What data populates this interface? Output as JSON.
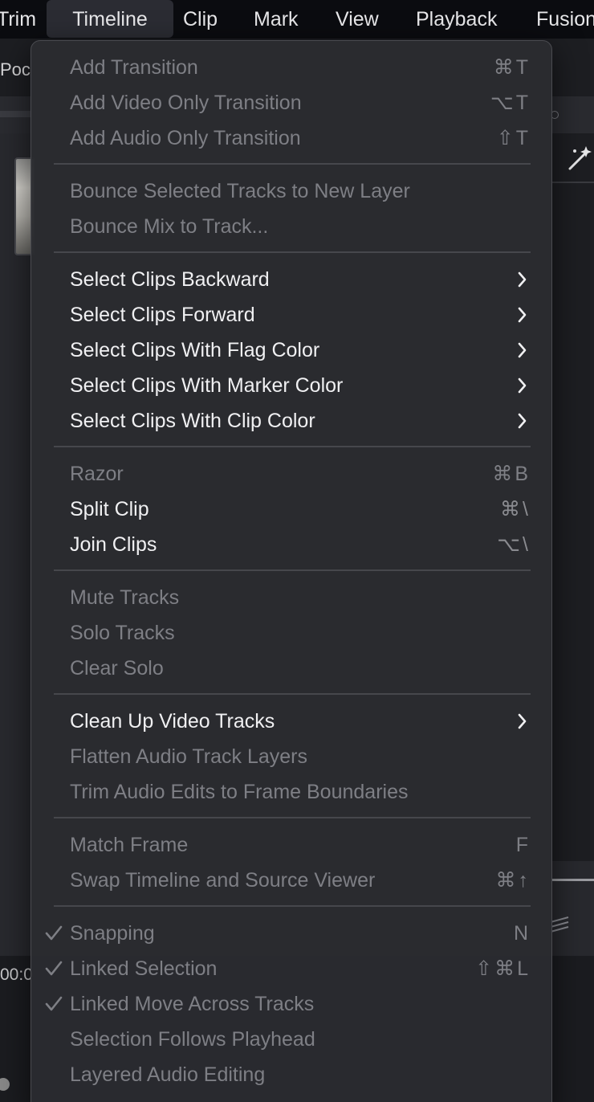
{
  "menubar": {
    "items": [
      "Trim",
      "Timeline",
      "Clip",
      "Mark",
      "View",
      "Playback",
      "Fusion"
    ],
    "active": "Timeline"
  },
  "background": {
    "toolbar_label": "Poc",
    "timecode": "00:0"
  },
  "menu": {
    "groups": [
      [
        {
          "label": "Add Transition",
          "shortcut": "⌘T",
          "enabled": false
        },
        {
          "label": "Add Video Only Transition",
          "shortcut": "⌥T",
          "enabled": false
        },
        {
          "label": "Add Audio Only Transition",
          "shortcut": "⇧T",
          "enabled": false
        }
      ],
      [
        {
          "label": "Bounce Selected Tracks to New Layer",
          "shortcut": "",
          "enabled": false
        },
        {
          "label": "Bounce Mix to Track...",
          "shortcut": "",
          "enabled": false
        }
      ],
      [
        {
          "label": "Select Clips Backward",
          "submenu": true,
          "enabled": true
        },
        {
          "label": "Select Clips Forward",
          "submenu": true,
          "enabled": true
        },
        {
          "label": "Select Clips With Flag Color",
          "submenu": true,
          "enabled": true
        },
        {
          "label": "Select Clips With Marker Color",
          "submenu": true,
          "enabled": true
        },
        {
          "label": "Select Clips With Clip Color",
          "submenu": true,
          "enabled": true
        }
      ],
      [
        {
          "label": "Razor",
          "shortcut": "⌘B",
          "enabled": false
        },
        {
          "label": "Split Clip",
          "shortcut": "⌘\\",
          "enabled": true
        },
        {
          "label": "Join Clips",
          "shortcut": "⌥\\",
          "enabled": true
        }
      ],
      [
        {
          "label": "Mute Tracks",
          "shortcut": "",
          "enabled": false
        },
        {
          "label": "Solo Tracks",
          "shortcut": "",
          "enabled": false
        },
        {
          "label": "Clear Solo",
          "shortcut": "",
          "enabled": false
        }
      ],
      [
        {
          "label": "Clean Up Video Tracks",
          "submenu": true,
          "enabled": true
        },
        {
          "label": "Flatten Audio Track Layers",
          "shortcut": "",
          "enabled": false
        },
        {
          "label": "Trim Audio Edits to Frame Boundaries",
          "shortcut": "",
          "enabled": false
        }
      ],
      [
        {
          "label": "Match Frame",
          "shortcut": "F",
          "enabled": false
        },
        {
          "label": "Swap Timeline and Source Viewer",
          "shortcut": "⌘↑",
          "enabled": false
        }
      ],
      [
        {
          "label": "Snapping",
          "shortcut": "N",
          "enabled": false,
          "checked": true
        },
        {
          "label": "Linked Selection",
          "shortcut": "⇧⌘L",
          "enabled": false,
          "checked": true
        },
        {
          "label": "Linked Move Across Tracks",
          "shortcut": "",
          "enabled": false,
          "checked": true
        },
        {
          "label": "Selection Follows Playhead",
          "shortcut": "",
          "enabled": false
        },
        {
          "label": "Layered Audio Editing",
          "shortcut": "",
          "enabled": false
        }
      ]
    ]
  },
  "icons": {
    "check": "checkmark-icon",
    "submenu": "chevron-right-icon",
    "wand": "magic-wand-icon"
  }
}
